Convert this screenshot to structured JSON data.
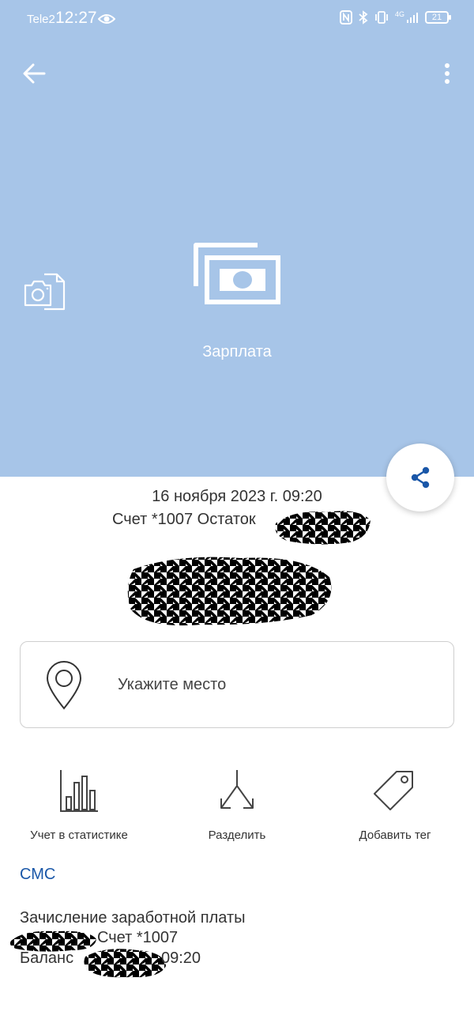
{
  "status_bar": {
    "carrier": "Tele2",
    "time": "12:27",
    "network": "4G",
    "battery": "21"
  },
  "header": {
    "category": "Зарплата",
    "icons": {
      "back": "arrow-left-icon",
      "menu": "more-vertical-icon",
      "camera": "camera-document-icon",
      "category": "banknote-icon",
      "share": "share-icon"
    }
  },
  "transaction": {
    "date": "16 ноября 2023 г. 09:20",
    "account": "Счет *1007 Остаток"
  },
  "location": {
    "placeholder": "Укажите место"
  },
  "actions": [
    {
      "label": "Учет в статистике",
      "icon": "bar-chart-icon"
    },
    {
      "label": "Разделить",
      "icon": "split-icon"
    },
    {
      "label": "Добавить тег",
      "icon": "tag-icon"
    }
  ],
  "sms": {
    "title": "СМС",
    "line1": "Зачисление заработной платы",
    "line2": "Счет *1007",
    "line3_prefix": "Баланс",
    "line3_suffix": "09:20"
  },
  "colors": {
    "header_bg": "#a7c5e8",
    "accent": "#1a57a8"
  }
}
